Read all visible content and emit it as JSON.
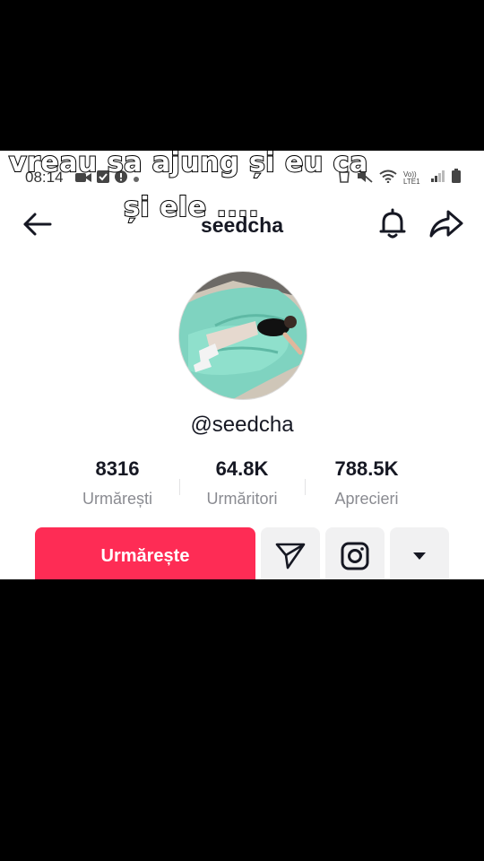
{
  "caption": {
    "line1": "vreau sa ajung și eu ca",
    "line2": "și ele ...."
  },
  "status_bar": {
    "time": "08:14",
    "network_label": "Vo)) LTE1"
  },
  "header": {
    "title": "seedcha"
  },
  "profile": {
    "handle": "@seedcha"
  },
  "stats": [
    {
      "value": "8316",
      "label": "Urmărești"
    },
    {
      "value": "64.8K",
      "label": "Urmăritori"
    },
    {
      "value": "788.5K",
      "label": "Aprecieri"
    }
  ],
  "actions": {
    "follow_label": "Urmărește"
  },
  "icons": {
    "back": "arrow-left-icon",
    "notifications": "bell-icon",
    "share": "share-icon",
    "message": "paper-plane-icon",
    "instagram": "instagram-icon",
    "more": "caret-down-icon"
  },
  "colors": {
    "follow_button": "#fe2c55",
    "secondary_button": "#f1f1f2",
    "text_primary": "#161823",
    "text_secondary": "#8a8b91"
  }
}
